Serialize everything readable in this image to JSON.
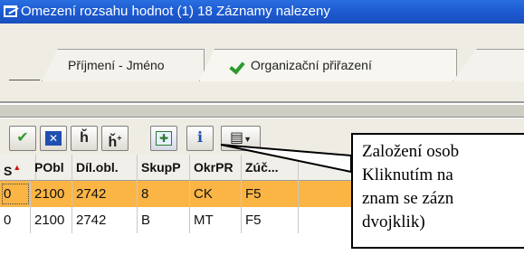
{
  "window": {
    "title": "Omezení rozsahu hodnot (1)   18 Záznamy nalezeny"
  },
  "tabs": [
    {
      "label": "Příjmení - Jméno",
      "icon": "none"
    },
    {
      "label": "Organizační přiřazení",
      "icon": "checkmark-green-icon"
    }
  ],
  "toolbar": {
    "buttons": [
      {
        "name": "confirm-button",
        "glyph": "✔",
        "color": "#2c9b2c"
      },
      {
        "name": "cancel-button",
        "glyph": "✖",
        "color": "#1f4fb0"
      },
      {
        "name": "find-button",
        "glyph": "🔍",
        "color": "#333333"
      },
      {
        "name": "find-next-button",
        "glyph": "🔍",
        "color": "#333333"
      },
      {
        "name": "create-record-button",
        "glyph": "✚",
        "color": "#2c7a2c"
      },
      {
        "name": "info-button",
        "glyph": "ℹ",
        "color": "#1f4fb0"
      },
      {
        "name": "document-button",
        "glyph": "▤",
        "color": "#333333"
      }
    ]
  },
  "table": {
    "columns": [
      "S",
      "PObl",
      "Díl.obl.",
      "SkupP",
      "OkrPR",
      "Zúč..."
    ],
    "rows": [
      [
        "0",
        "2100",
        "2742",
        "8",
        "CK",
        "F5"
      ],
      [
        "0",
        "2100",
        "2742",
        "B",
        "MT",
        "F5"
      ]
    ],
    "selected_row": 0
  },
  "callout": {
    "lines": [
      "Založení osob",
      "Kliknutím na",
      "znam se zázn",
      "dvojklik)"
    ]
  },
  "colors": {
    "titlebar": "#1d5ad1",
    "selected_row": "#fbb545",
    "sort_arrow": "#d01010"
  }
}
